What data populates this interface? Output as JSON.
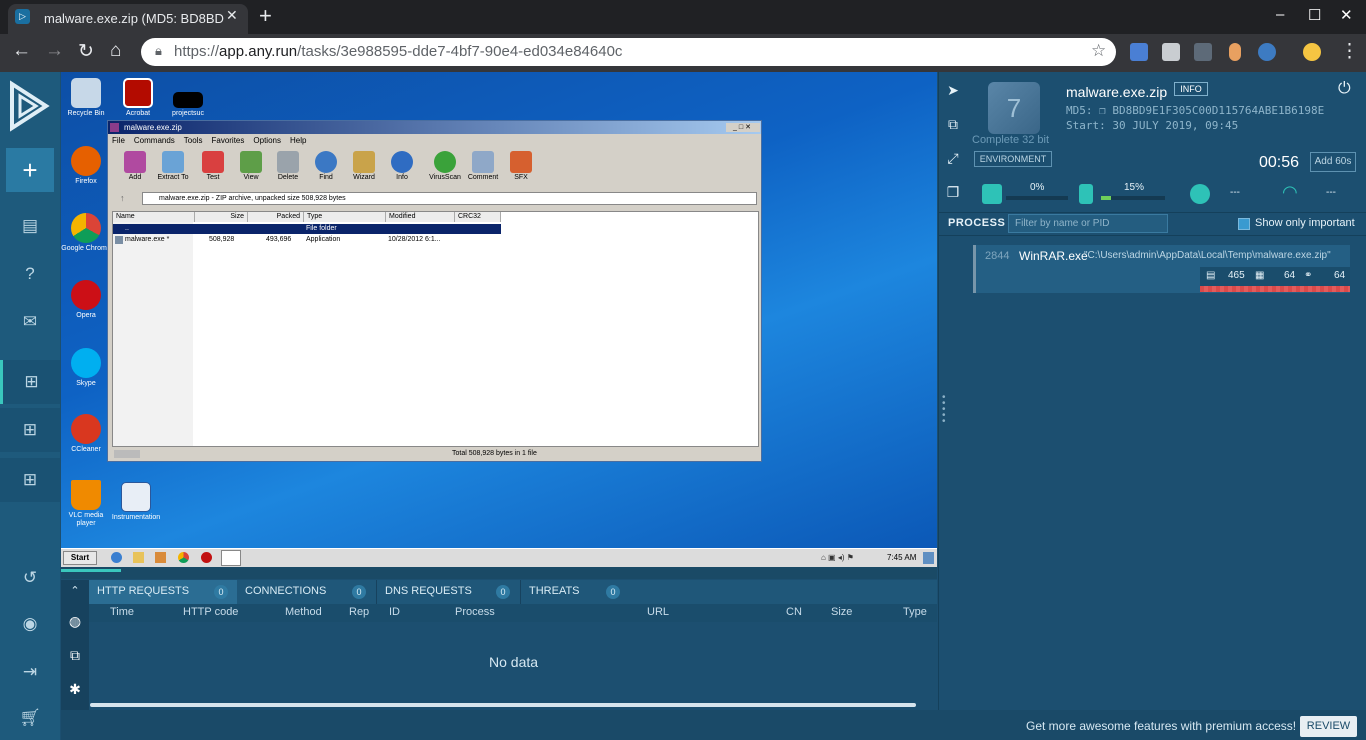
{
  "browser": {
    "tab_title": "malware.exe.zip (MD5: BD8BD",
    "tab_favicon": "anyrun-favicon",
    "new_tab": "+",
    "url_prefix": "https://",
    "url_host": "app.any.run",
    "url_path": "/tasks/3e988595-dde7-4bf7-90e4-ed034e84640c",
    "controls": {
      "minimize": "–",
      "maximize": "☐",
      "close": "✕"
    }
  },
  "left_nav": {
    "add": "+",
    "items": [
      "document-icon",
      "help-icon",
      "mail-icon",
      "windows-icon",
      "windows-icon",
      "windows-icon"
    ],
    "bottom": [
      "history-icon",
      "user-icon",
      "logout-icon",
      "cart-icon"
    ]
  },
  "vm": {
    "desktop_icons": [
      {
        "label": "Recycle Bin"
      },
      {
        "label": "Acrobat"
      },
      {
        "label": "projectsuc"
      },
      {
        "label": "Firefox"
      },
      {
        "label": "Google Chrome"
      },
      {
        "label": "Opera"
      },
      {
        "label": "Skype"
      },
      {
        "label": "CCleaner"
      },
      {
        "label": "VLC media player"
      },
      {
        "label": "Instrumentation"
      }
    ],
    "taskbar": {
      "start": "Start",
      "clock": "7:45 AM"
    },
    "winrar": {
      "title": "malware.exe.zip",
      "menu": [
        "File",
        "Commands",
        "Tools",
        "Favorites",
        "Options",
        "Help"
      ],
      "tools": [
        "Add",
        "Extract To",
        "Test",
        "View",
        "Delete",
        "Find",
        "Wizard",
        "Info",
        "VirusScan",
        "Comment",
        "SFX"
      ],
      "address": "malware.exe.zip - ZIP archive, unpacked size 508,928 bytes",
      "columns": [
        "Name",
        "Size",
        "Packed",
        "Type",
        "Modified",
        "CRC32"
      ],
      "rows": [
        {
          "name": "..",
          "size": "",
          "packed": "",
          "type": "File folder",
          "modified": ""
        },
        {
          "name": "malware.exe *",
          "size": "508,928",
          "packed": "493,696",
          "type": "Application",
          "modified": "10/28/2012 6:1..."
        }
      ],
      "status": "Total 508,928 bytes in 1 file"
    }
  },
  "bottom_panel": {
    "tabs": [
      {
        "label": "HTTP REQUESTS",
        "count": "0"
      },
      {
        "label": "CONNECTIONS",
        "count": "0"
      },
      {
        "label": "DNS REQUESTS",
        "count": "0"
      },
      {
        "label": "THREATS",
        "count": "0"
      }
    ],
    "columns": [
      "Time",
      "HTTP code",
      "Method",
      "Rep",
      "ID",
      "Process",
      "URL",
      "CN",
      "Size",
      "Type"
    ],
    "empty": "No data",
    "promo": "Get more awesome features with premium access!",
    "review": "REVIEW"
  },
  "task": {
    "os": "Complete 32 bit",
    "os_logo": "7",
    "filename": "malware.exe.zip",
    "info": "INFO",
    "md5_label": "MD5:",
    "md5": "BD8BD9E1F305C00D115764ABE1B6198E",
    "start_label": "Start:",
    "start": "30 JULY 2019, 09:45",
    "environment": "ENVIRONMENT",
    "timer": "00:56",
    "add_time": "Add 60s",
    "cpu": "0%",
    "ram": "15%",
    "disk": "---",
    "net": "---",
    "cpu_level": 0.0,
    "ram_level": 0.15
  },
  "process": {
    "title": "PROCESS",
    "filter_placeholder": "Filter by name or PID",
    "only_important": "Show only important",
    "items": [
      {
        "pid": "2844",
        "name": "WinRAR.exe",
        "cmd": "\"C:\\Users\\admin\\AppData\\Local\\Temp\\malware.exe.zip\"",
        "files": "465",
        "reg": "64",
        "mods": "64"
      }
    ]
  }
}
